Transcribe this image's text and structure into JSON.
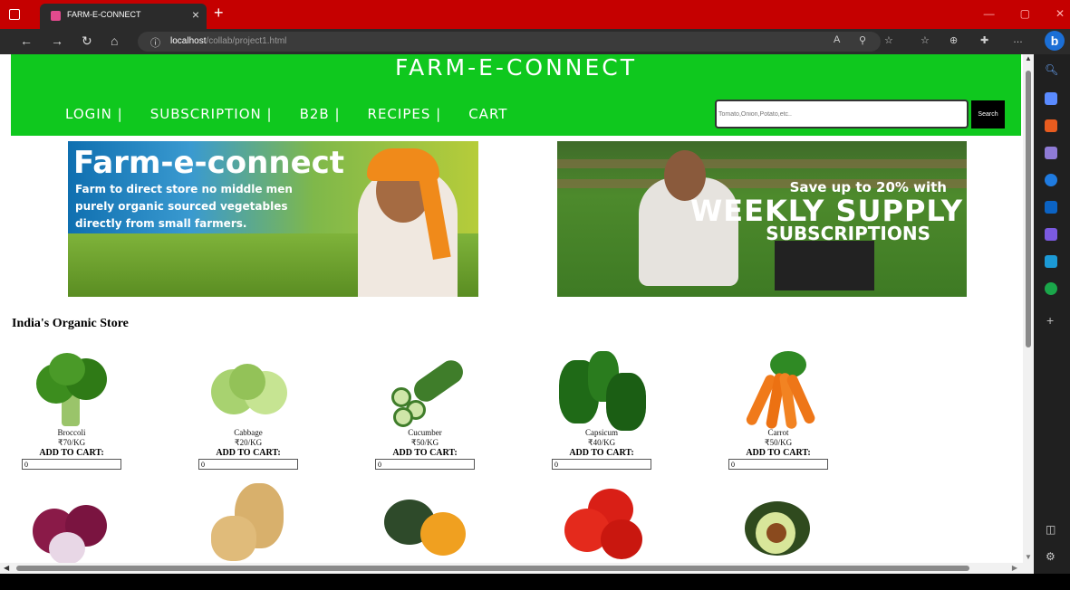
{
  "browser": {
    "tab_title": "FARM-E-CONNECT",
    "url_host": "localhost",
    "url_path": "/collab/project1.html"
  },
  "site": {
    "title": "FARM-E-CONNECT",
    "menu": [
      "LOGIN |",
      "SUBSCRIPTION |",
      "B2B |",
      "RECIPES |",
      "CART"
    ],
    "search_placeholder": "Tomato,Onion,Potato,etc..",
    "search_button": "Search"
  },
  "banners": {
    "left": {
      "heading": "Farm-e-connect",
      "lines": [
        "Farm to direct store no middle men",
        "purely organic sourced vegetables",
        "directly from small farmers."
      ]
    },
    "right": {
      "line1": "Save up to 20% with",
      "line2": "WEEKLY SUPPLY",
      "line3": "SUBSCRIPTIONS"
    }
  },
  "store": {
    "title": "India's Organic Store",
    "cart_label": "ADD TO CART:",
    "products": [
      {
        "name": "Broccoli",
        "price": "₹70/KG",
        "qty": "0",
        "icon": "broccoli-image",
        "color": "#3c8d1e"
      },
      {
        "name": "Cabbage",
        "price": "₹20/KG",
        "qty": "0",
        "icon": "cabbage-image",
        "color": "#a8d270"
      },
      {
        "name": "Cucumber",
        "price": "₹50/KG",
        "qty": "0",
        "icon": "cucumber-image",
        "color": "#3f7d2a"
      },
      {
        "name": "Capsicum",
        "price": "₹40/KG",
        "qty": "0",
        "icon": "capsicum-image",
        "color": "#1f6a17"
      },
      {
        "name": "Carrot",
        "price": "₹50/KG",
        "qty": "0",
        "icon": "carrot-image",
        "color": "#f07a1a"
      }
    ],
    "second_row_icons": [
      "onion-image",
      "potato-image",
      "pumpkin-image",
      "tomato-image",
      "avocado-image"
    ]
  }
}
